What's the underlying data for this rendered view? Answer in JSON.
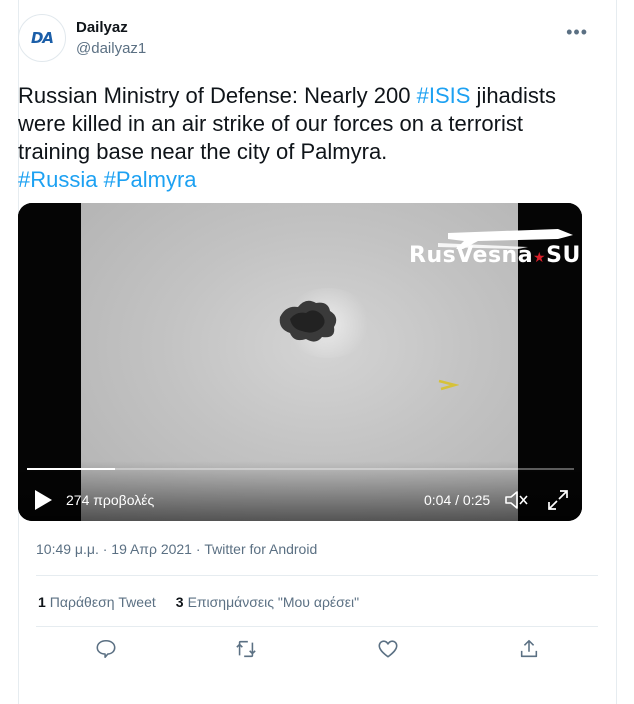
{
  "account": {
    "display_name": "Dailyaz",
    "handle": "@dailyaz1",
    "avatar_text": "DA"
  },
  "tweet": {
    "text_part1": "Russian Ministry of Defense: Nearly 200 ",
    "hashtag_isis": "#ISIS",
    "text_part2": " jihadists were killed in an air strike of our forces on a terrorist training base near the city of Palmyra.",
    "hashtag_russia": "#Russia",
    "hashtag_palmyra": "#Palmyra"
  },
  "video": {
    "watermark_part1": "RusVesna",
    "watermark_star": "★",
    "watermark_part2": "SU",
    "views": "274 προβολές",
    "time": "0:04 / 0:25",
    "progress_fraction": 0.16
  },
  "meta": {
    "timestamp": "10:49 μ.μ. · 19 Απρ 2021 · Twitter for Android"
  },
  "stats": {
    "quotes_count": "1",
    "quotes_label": "Παράθεση Tweet",
    "likes_count": "3",
    "likes_label": "Επισημάνσεις \"Μου αρέσει\""
  },
  "colors": {
    "link": "#1da1f2",
    "secondary_text": "#5b7083",
    "border": "#e6ecf0"
  },
  "icons": [
    "more-icon",
    "play-icon",
    "mute-icon",
    "fullscreen-icon",
    "reply-icon",
    "retweet-icon",
    "like-icon",
    "share-icon"
  ]
}
